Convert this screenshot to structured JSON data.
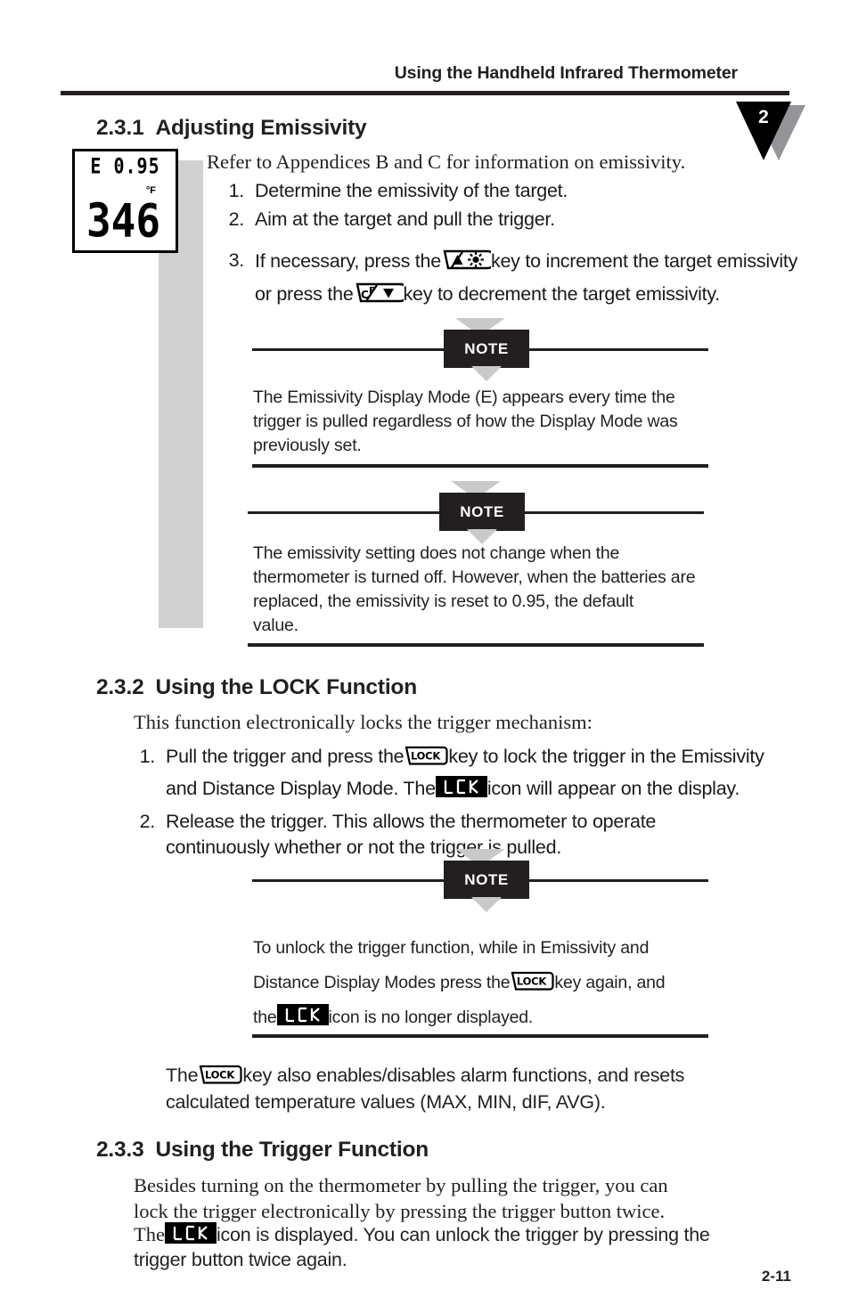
{
  "header": {
    "title": "Using the Handheld Infrared Thermometer",
    "chapter_number": "2"
  },
  "lcd_display": {
    "emissivity_line": "E 0.95",
    "unit": "°F",
    "reading": "346"
  },
  "sections": [
    {
      "number": "2.3.1",
      "title": "Adjusting Emissivity",
      "intro": "Refer to Appendices B and C for information on emissivity.",
      "steps": [
        {
          "num": "1.",
          "text": "Determine the emissivity of the target."
        },
        {
          "num": "2.",
          "text": "Aim at the target and pull the trigger."
        },
        {
          "num": "3.",
          "text_a": "If necessary, press the",
          "icon_a": "up-sun-key-icon",
          "text_b": "key to increment the target emissivity",
          "text_c": "or press the",
          "icon_b": "celsius-fahrenheit-down-key-icon",
          "text_d": "key to decrement the target emissivity."
        }
      ]
    },
    {
      "number": "2.3.2",
      "title": "Using the LOCK Function",
      "intro": "This function electronically locks the trigger mechanism:",
      "steps": [
        {
          "num": "1.",
          "text_a": "Pull the trigger and press the",
          "icon_a": "lock-key-icon",
          "text_b": "key to lock the trigger in the Emissivity",
          "text_c": "and Distance Display Mode. The",
          "icon_b": "lck-display-icon",
          "text_d": "icon will appear on the display."
        },
        {
          "num": "2.",
          "text": "Release the trigger. This allows the thermometer to operate continuously whether or not the trigger is pulled."
        }
      ],
      "closing": {
        "text_a": "The",
        "icon_a": "lock-key-icon",
        "text_b": "key also enables/disables alarm functions, and resets",
        "text_c": "calculated temperature values (MAX, MIN, dIF, AVG)."
      }
    },
    {
      "number": "2.3.3",
      "title": "Using the Trigger Function",
      "body_line_1": "Besides turning on the thermometer by pulling the trigger, you can",
      "body_line_2": "lock the trigger electronically by pressing the trigger button twice.",
      "body_line_3_a": "The",
      "body_line_3_icon": "lck-display-icon",
      "body_line_3_b": "icon is displayed. You can unlock the trigger by pressing the",
      "body_line_4": "trigger button twice again."
    }
  ],
  "notes": [
    {
      "label": "NOTE",
      "line_1": "The Emissivity Display Mode (E) appears every time the",
      "line_2": "trigger is pulled regardless of how the Display Mode was",
      "line_3": "previously set."
    },
    {
      "label": "NOTE",
      "line_1": "The emissivity setting does not change when the",
      "line_2": "thermometer is turned off. However, when the batteries are",
      "line_3": "replaced, the emissivity is reset to 0.95, the default",
      "line_4": "value."
    },
    {
      "label": "NOTE",
      "line_1": "To unlock the trigger function, while in Emissivity and",
      "line_2_a": "Distance Display Modes press the",
      "line_2_icon": "lock-key-icon",
      "line_2_b": "key again, and",
      "line_3_a": "the",
      "line_3_icon": "lck-display-icon",
      "line_3_b": "icon is no longer displayed."
    }
  ],
  "icon_labels": {
    "lock_key": "LOCK",
    "lck_display": "LCK",
    "celsius_fahrenheit": "°C/°F"
  },
  "footer": {
    "page_number": "2-11"
  },
  "colors": {
    "ink": "#231f20",
    "note_box": "#231f20",
    "gray_strip": "#d0d0d0",
    "gray_triangle": "#c9c9c9",
    "chapter_shadow": "#939598"
  }
}
